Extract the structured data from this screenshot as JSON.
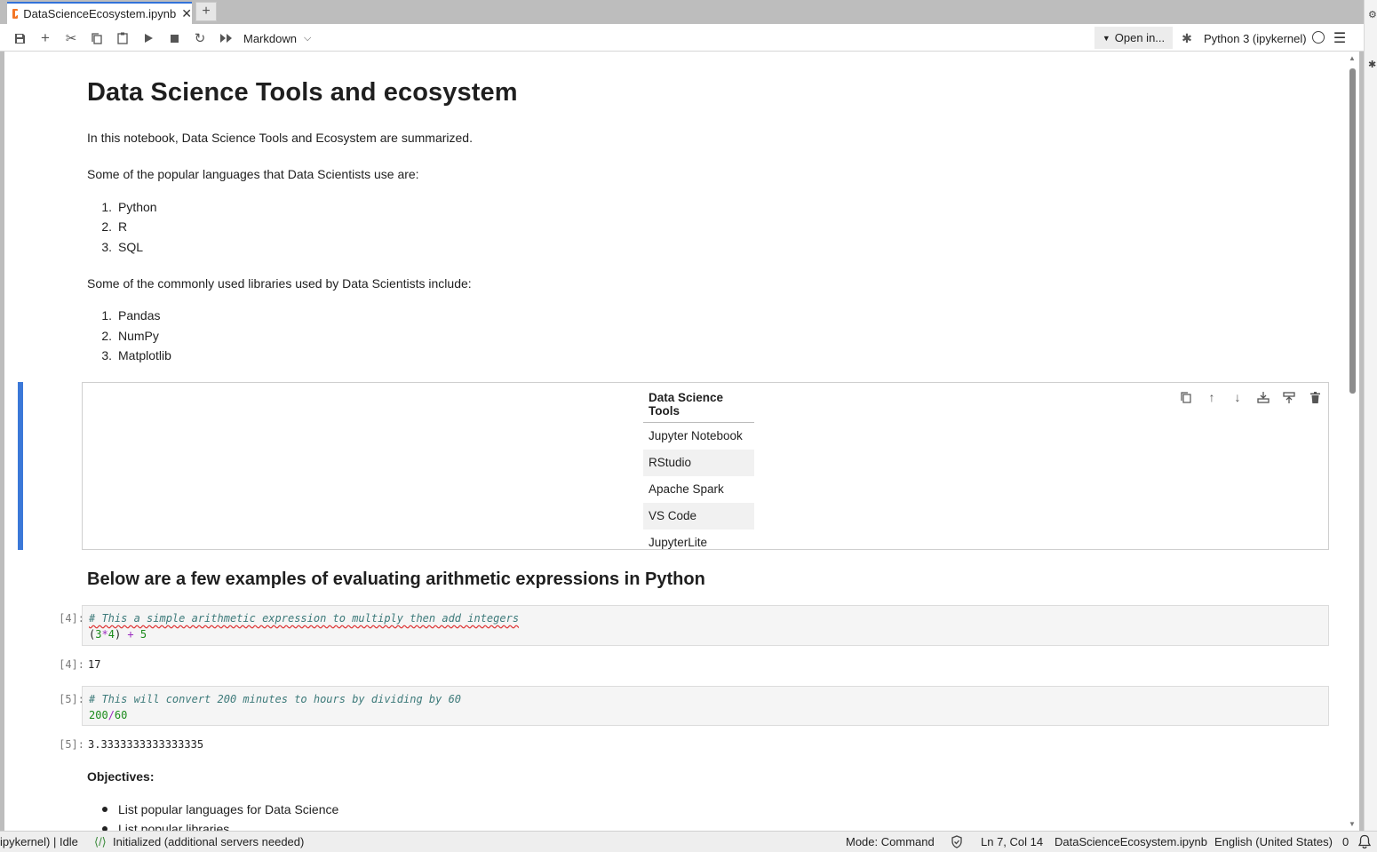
{
  "tab": {
    "title": "DataScienceEcosystem.ipynb",
    "close": "✕",
    "new": "+"
  },
  "toolbar": {
    "cell_type": "Markdown",
    "open_in": "Open in...",
    "kernel": "Python 3 (ipykernel)"
  },
  "notebook": {
    "title": "Data Science Tools and ecosystem",
    "intro": "In this notebook, Data Science Tools and Ecosystem are summarized.",
    "languages_intro": "Some of the popular languages that Data Scientists use are:",
    "languages": [
      "Python",
      "R",
      "SQL"
    ],
    "libraries_intro": "Some of the commonly used libraries used by Data Scientists include:",
    "libraries": [
      "Pandas",
      "NumPy",
      "Matplotlib"
    ],
    "tools_table": {
      "header": "Data Science Tools",
      "rows": [
        "Jupyter Notebook",
        "RStudio",
        "Apache Spark",
        "VS Code",
        "JupyterLite"
      ]
    },
    "arith_heading": "Below are a few examples of evaluating arithmetic expressions in Python",
    "cells": [
      {
        "prompt_in": "[4]:",
        "comment": "# This a simple arithmetic expression to multiply then add integers",
        "code": [
          "(",
          "3",
          "*",
          "4",
          ") ",
          "+",
          " ",
          "5"
        ],
        "prompt_out": "[4]:",
        "output": "17"
      },
      {
        "prompt_in": "[5]:",
        "comment": "# This will convert 200 minutes to hours by dividing by 60",
        "code": [
          "200",
          "/",
          "60"
        ],
        "prompt_out": "[5]:",
        "output": "3.3333333333333335"
      }
    ],
    "objectives_heading": "Objectives:",
    "objectives": [
      "List popular languages for Data Science",
      "List popular libraries"
    ]
  },
  "statusbar": {
    "kernel_state": "ipykernel) | Idle",
    "lsp": "Initialized (additional servers needed)",
    "mode": "Mode: Command",
    "position": "Ln 7, Col 14",
    "file": "DataScienceEcosystem.ipynb",
    "language": "English (United States)",
    "notifications": "0"
  },
  "icons": [
    "save-icon",
    "add-cell-icon",
    "cut-icon",
    "copy-icon",
    "paste-icon",
    "run-icon",
    "stop-icon",
    "restart-icon",
    "fast-forward-icon",
    "bug-icon",
    "menu-icon",
    "bell-icon"
  ]
}
